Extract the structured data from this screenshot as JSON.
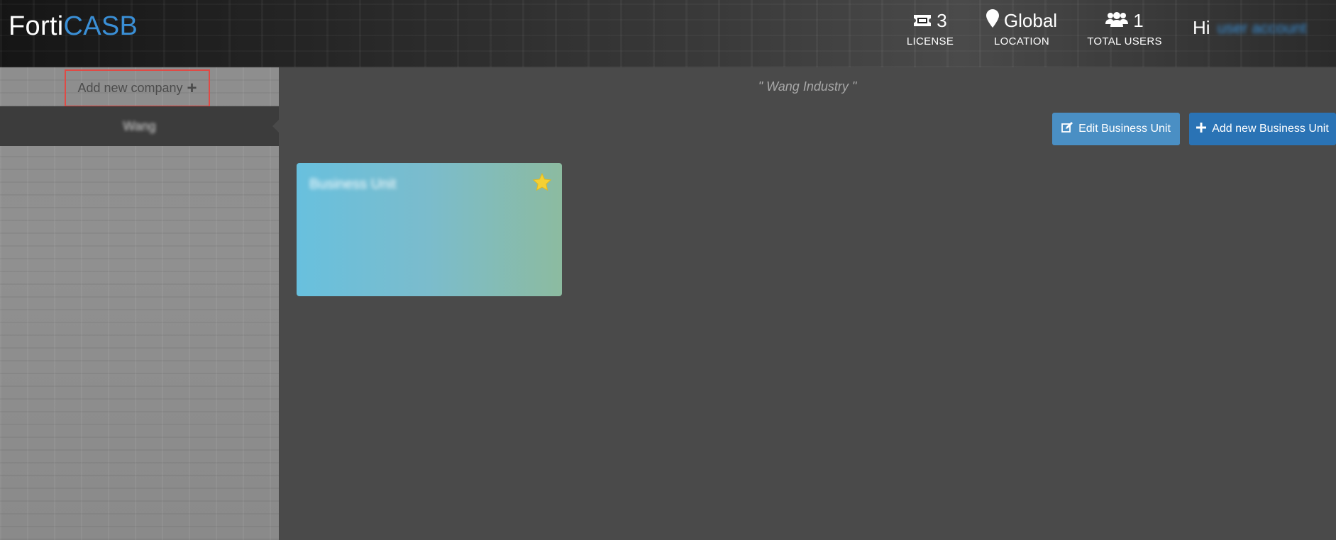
{
  "header": {
    "logo_part1": "Forti",
    "logo_part2": "CASB",
    "license": {
      "value": "3",
      "label": "LICENSE",
      "icon": "ticket-icon"
    },
    "location": {
      "value": "Global",
      "label": "LOCATION",
      "icon": "map-pin-icon"
    },
    "users": {
      "value": "1",
      "label": "TOTAL USERS",
      "icon": "users-icon"
    },
    "greeting": "Hi",
    "user_name": "user account"
  },
  "sidebar": {
    "add_company_label": "Add new company",
    "companies": [
      {
        "label": "Wang"
      }
    ]
  },
  "main": {
    "company_title": "\" Wang Industry \"",
    "edit_button_label": "Edit Business Unit",
    "add_button_label": "Add new Business Unit",
    "business_units": [
      {
        "name": "Business Unit",
        "favorite": true
      }
    ]
  },
  "colors": {
    "brand_blue": "#3a8fd6",
    "edit_button": "#4a8fc4",
    "add_button": "#2a73b5",
    "highlight_border": "#e04a45",
    "star": "#f5d033"
  }
}
